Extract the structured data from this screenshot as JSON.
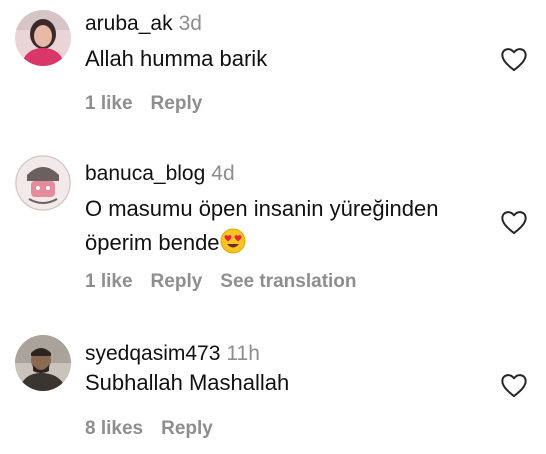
{
  "comments": [
    {
      "username": "aruba_ak",
      "age": "3d",
      "text": "Allah humma barik",
      "likes": "1 like",
      "reply": "Reply",
      "avatar_icon": "avatar-woman-pink-icon"
    },
    {
      "username": "banuca_blog",
      "age": "4d",
      "text_line1": "O masumu öpen insanin yüreğinden",
      "text_line2": "öperim bende",
      "emoji": "heart-eyes-emoji",
      "likes": "1 like",
      "reply": "Reply",
      "translate": "See translation",
      "avatar_icon": "avatar-illustration-icon"
    },
    {
      "username": "syedqasim473",
      "age": "11h",
      "text": "Subhallah Mashallah",
      "likes": "8 likes",
      "reply": "Reply",
      "avatar_icon": "avatar-man-icon"
    }
  ],
  "colors": {
    "text": "#111111",
    "muted": "#8e8e8e",
    "heart_outline": "#262626"
  }
}
